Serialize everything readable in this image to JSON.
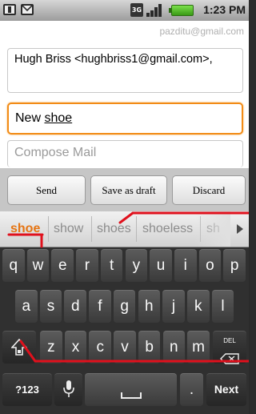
{
  "status_bar": {
    "time": "1:23 PM",
    "left_icons": [
      "sim-card-icon",
      "gmail-notification-icon"
    ],
    "right_icons": [
      "network-3g-icon",
      "signal-strength-icon",
      "battery-icon"
    ],
    "network_label": "3G",
    "battery_color": "#4cbf20"
  },
  "compose": {
    "account": "pazditu@gmail.com",
    "to_value": "Hugh Briss <hughbriss1@gmail.com>,",
    "subject_prefix": "New ",
    "subject_composing": "shoe",
    "body_placeholder": "Compose Mail",
    "focus_color": "#f28b16"
  },
  "buttons": {
    "send": "Send",
    "save_draft": "Save as draft",
    "discard": "Discard"
  },
  "suggestions": {
    "items": [
      "shoe",
      "show",
      "shoes",
      "shoeless",
      "sh"
    ],
    "active_color": "#e57412",
    "more_icon": "chevron-right-icon"
  },
  "keyboard": {
    "row1": [
      "q",
      "w",
      "e",
      "r",
      "t",
      "y",
      "u",
      "i",
      "o",
      "p"
    ],
    "row2": [
      "a",
      "s",
      "d",
      "f",
      "g",
      "h",
      "j",
      "k",
      "l"
    ],
    "row3": [
      "z",
      "x",
      "c",
      "v",
      "b",
      "n",
      "m"
    ],
    "shift_icon": "shift-icon",
    "delete_label": "DEL",
    "delete_icon": "backspace-icon",
    "symbols": "?123",
    "mic_icon": "microphone-icon",
    "space_icon": "space-icon",
    "period": ".",
    "next": "Next"
  },
  "annotation_color": "#e0101c"
}
